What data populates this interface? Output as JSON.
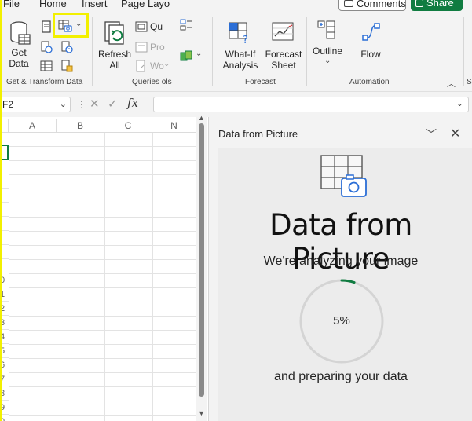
{
  "menu": {
    "file": "File",
    "home": "Home",
    "insert": "Insert",
    "page_layout": "Page Layo",
    "comments": "Comments",
    "share": "Share"
  },
  "ribbon": {
    "get_data_line1": "Get",
    "get_data_line2": "Data",
    "get_transform_group": "Get & Transform Data",
    "refresh_line1": "Refresh",
    "refresh_line2": "All",
    "queries_item1": "Qu",
    "queries_item2": "Pro",
    "queries_item3": "Wo",
    "queries_group": "Queries ols",
    "whatif_line1": "What-If",
    "whatif_line2": "Analysis",
    "forecast_line1": "Forecast",
    "forecast_line2": "Sheet",
    "forecast_group": "Forecast",
    "outline": "Outline",
    "flow": "Flow",
    "automation_group": "Automation",
    "cut_label": "S"
  },
  "formula_bar": {
    "name_box": "F2",
    "fx": "fx",
    "value": ""
  },
  "grid": {
    "columns": [
      "A",
      "B",
      "C",
      "N"
    ],
    "rows": [
      "",
      "",
      "",
      "",
      "",
      "",
      "",
      "",
      "",
      "0",
      "1",
      "2",
      "3",
      "4",
      "5",
      "6",
      "7",
      "8",
      "9",
      "0"
    ]
  },
  "pane": {
    "header_title": "Data from Picture",
    "title": "Data from Picture",
    "analyzing": "We're analyzing your image",
    "progress": "5%",
    "progress_fraction": 0.05,
    "preparing": "and preparing your data"
  },
  "colors": {
    "excel_green": "#107c41",
    "highlight_yellow": "#f2f000",
    "icon_blue": "#2b6ed6"
  }
}
